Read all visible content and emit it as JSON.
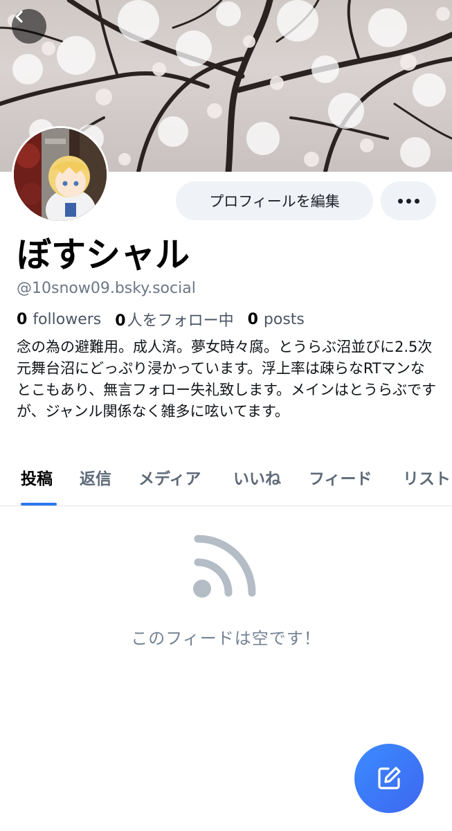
{
  "profile": {
    "display_name": "ぼすシャル",
    "handle": "@10snow09.bsky.social",
    "followers_count": "0",
    "followers_label": "followers",
    "following_count": "0",
    "following_label": "人をフォロー中",
    "posts_count": "0",
    "posts_label": "posts",
    "bio": "念の為の避難用。成人済。夢女時々腐。とうらぶ沼並びに2.5次元舞台沼にどっぷり浸かっています。浮上率は疎らなRTマンなとこもあり、無言フォロー失礼致します。メインはとうらぶですが、ジャンル関係なく雑多に呟いてます。"
  },
  "actions": {
    "edit_profile_label": "プロフィールを編集",
    "more_icon": "ellipsis-icon"
  },
  "header": {
    "back_icon": "chevron-left-icon"
  },
  "tabs": [
    {
      "label": "投稿",
      "active": true
    },
    {
      "label": "返信",
      "active": false
    },
    {
      "label": "メディア",
      "active": false
    },
    {
      "label": "いいね",
      "active": false
    },
    {
      "label": "フィード",
      "active": false
    },
    {
      "label": "リスト",
      "active": false
    }
  ],
  "empty_state": {
    "icon": "rss-feed-icon",
    "message": "このフィードは空です！"
  },
  "fab": {
    "icon": "compose-icon"
  },
  "colors": {
    "accent": "#2b77f0",
    "fab": "#3d7bf6",
    "muted_text": "#6b7785",
    "button_bg": "#eff2f6"
  }
}
